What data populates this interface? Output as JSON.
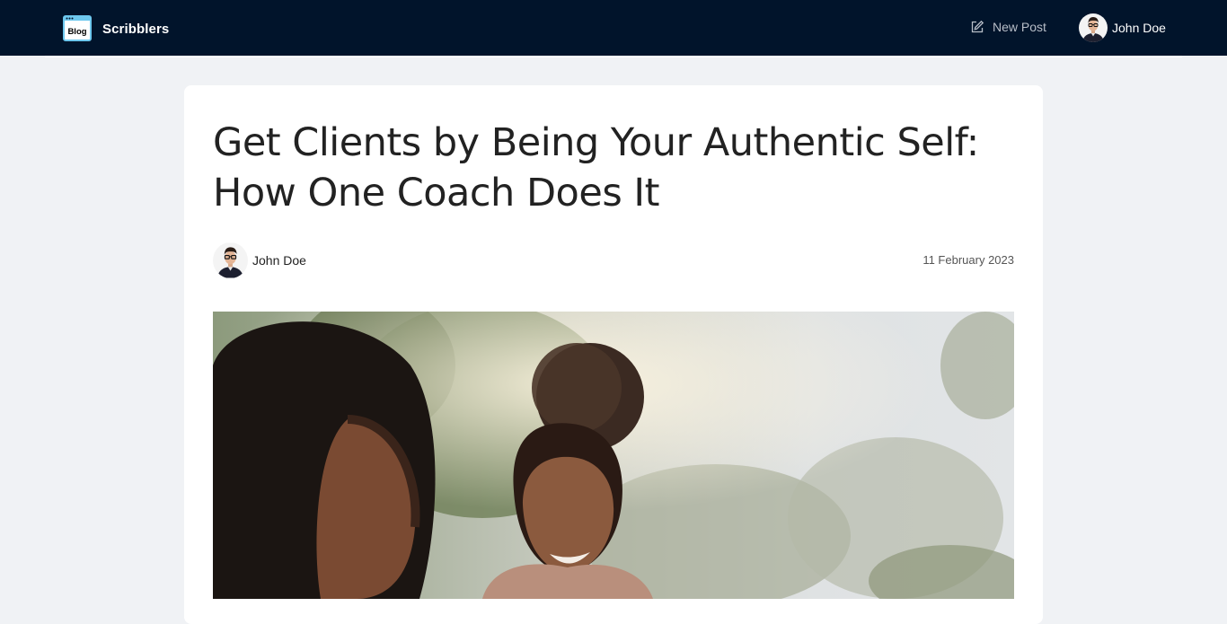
{
  "navbar": {
    "logo_text": "Blog",
    "brand_name": "Scribblers",
    "new_post_label": "New Post",
    "user_name": "John Doe"
  },
  "post": {
    "title": "Get Clients by Being Your Authentic Self: How One Coach Does It",
    "author_name": "John Doe",
    "date": "11 February 2023"
  },
  "colors": {
    "navbar_bg": "#01142b",
    "page_bg": "#f0f2f5",
    "card_bg": "#ffffff"
  }
}
